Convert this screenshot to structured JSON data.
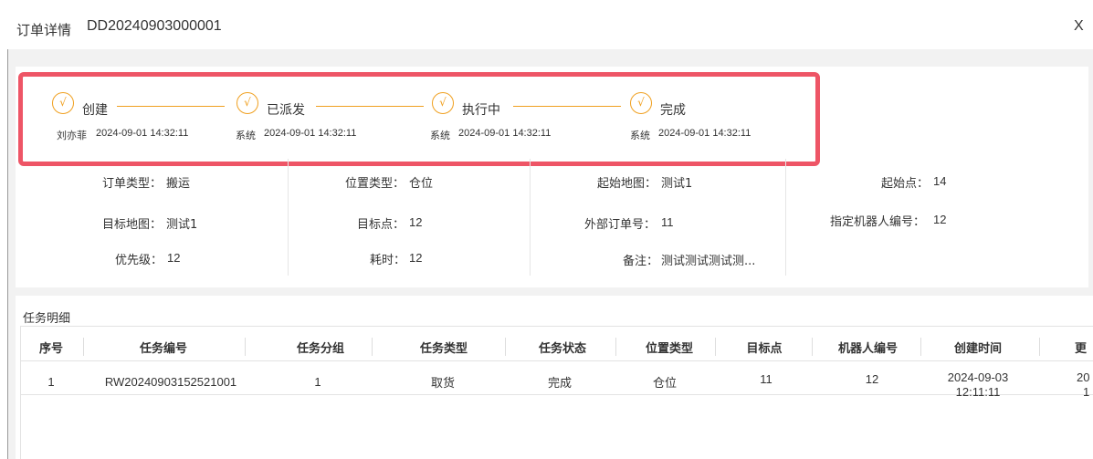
{
  "header": {
    "title": "订单详情",
    "order_no": "DD20240903000001",
    "close_label": "X"
  },
  "progress": {
    "steps": [
      {
        "label": "创建",
        "icon": "√",
        "operator": "刘亦菲",
        "time": "2024-09-01 14:32:11"
      },
      {
        "label": "已派发",
        "icon": "√",
        "operator": "系统",
        "time": "2024-09-01 14:32:11"
      },
      {
        "label": "执行中",
        "icon": "√",
        "operator": "系统",
        "time": "2024-09-01 14:32:11"
      },
      {
        "label": "完成",
        "icon": "√",
        "operator": "系统",
        "time": "2024-09-01 14:32:11"
      }
    ]
  },
  "info": {
    "order_type": {
      "label": "订单类型：",
      "value": "搬运"
    },
    "location_type": {
      "label": "位置类型：",
      "value": "仓位"
    },
    "start_map": {
      "label": "起始地图：",
      "value": "测试1"
    },
    "start_point": {
      "label": "起始点：",
      "value": "14"
    },
    "target_map": {
      "label": "目标地图：",
      "value": "测试1"
    },
    "target_point": {
      "label": "目标点：",
      "value": "12"
    },
    "external_order": {
      "label": "外部订单号：",
      "value": "11"
    },
    "robot_no": {
      "label": "指定机器人编号：",
      "value": "12"
    },
    "priority": {
      "label": "优先级：",
      "value": "12"
    },
    "duration": {
      "label": "耗时：",
      "value": "12"
    },
    "remark": {
      "label": "备注：",
      "value": "测试测试测试测..."
    }
  },
  "tasks": {
    "section_title": "任务明细",
    "columns": [
      "序号",
      "任务编号",
      "任务分组",
      "任务类型",
      "任务状态",
      "位置类型",
      "目标点",
      "机器人编号",
      "创建时间",
      "更"
    ],
    "rows": [
      {
        "index": "1",
        "task_no": "RW20240903152521001",
        "group": "1",
        "type": "取货",
        "status": "完成",
        "location_type": "仓位",
        "target": "11",
        "robot": "12",
        "created_date": "2024-09-03",
        "created_time": "12:11:11",
        "updated_date": "20",
        "updated_time": "1"
      }
    ]
  },
  "colors": {
    "accent": "#f0a020",
    "highlight": "#ee5566",
    "background": "#f2f2f2"
  }
}
